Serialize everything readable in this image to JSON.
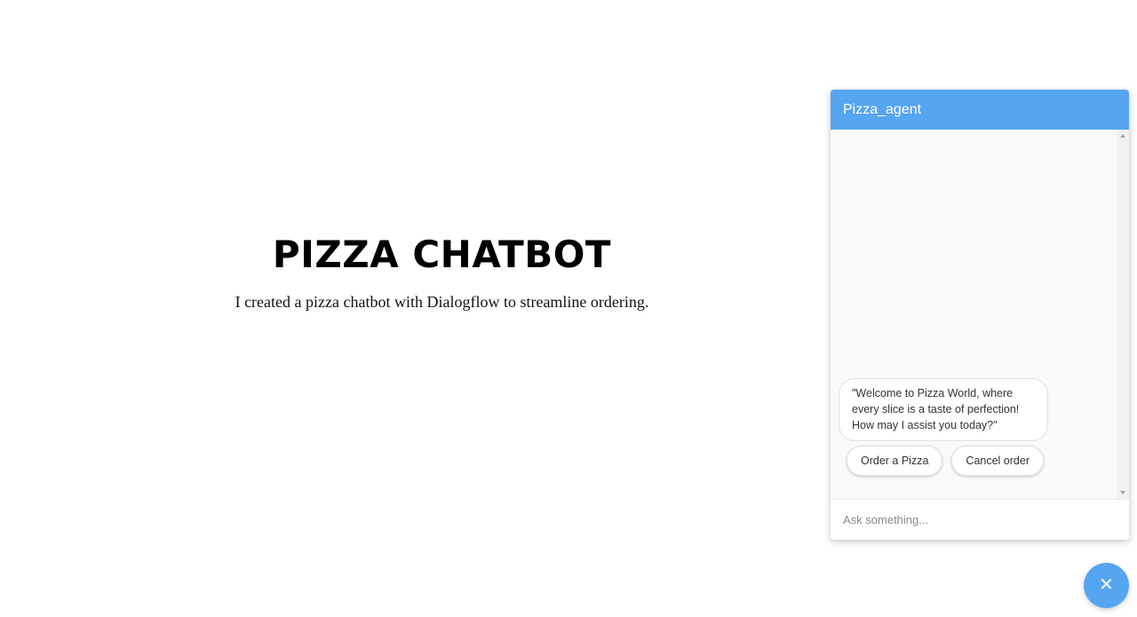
{
  "hero": {
    "title": "PIZZA CHATBOT",
    "subtitle": "I created a pizza chatbot with Dialogflow to streamline ordering."
  },
  "chat": {
    "title": "Pizza_agent",
    "messages": [
      {
        "from": "agent",
        "text": "\"Welcome to Pizza World, where every slice is a taste of perfection! How may I assist you today?\""
      }
    ],
    "suggestions": [
      "Order a Pizza",
      "Cancel order"
    ],
    "input_placeholder": "Ask something...",
    "close_icon": "close-icon",
    "colors": {
      "accent": "#56a5f1",
      "body_bg": "#fafafa"
    }
  }
}
